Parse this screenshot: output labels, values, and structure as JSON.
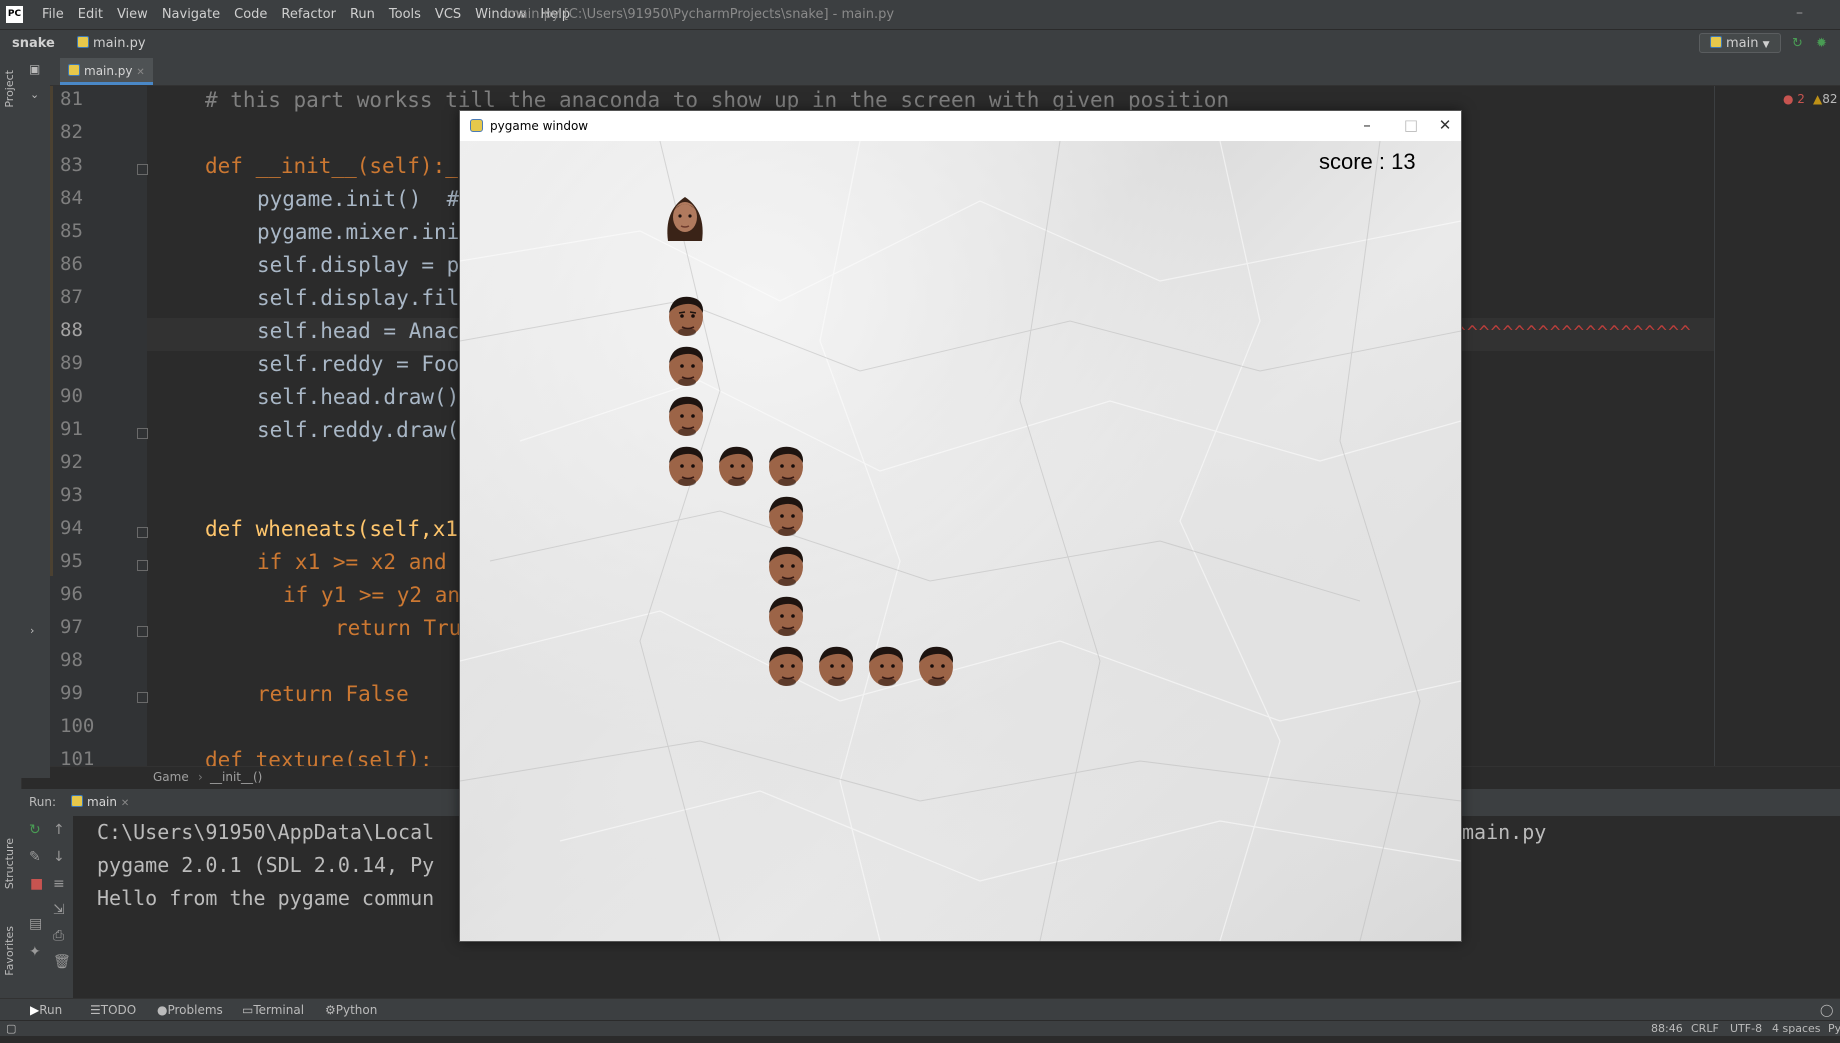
{
  "menubar": {
    "logo": "PC",
    "items": [
      "File",
      "Edit",
      "View",
      "Navigate",
      "Code",
      "Refactor",
      "Run",
      "Tools",
      "VCS",
      "Window",
      "Help"
    ],
    "window_title": "main.py [C:\\Users\\91950\\PycharmProjects\\snake] - main.py",
    "minimize": "–"
  },
  "navbar": {
    "project": "snake",
    "file": "main.py",
    "run_config": "main"
  },
  "leftstrip": {
    "project_label": "Project",
    "structure_label": "Structure",
    "favorites_label": "Favorites"
  },
  "editor": {
    "tab": "main.py",
    "inspections": {
      "errors": "2",
      "warnings": "82"
    },
    "lines": [
      {
        "n": "81",
        "code": "# this part workss till the anaconda to show up in the screen with given position"
      },
      {
        "n": "82",
        "code": ""
      },
      {
        "n": "83",
        "code": "def __init__(self):_"
      },
      {
        "n": "84",
        "code": "pygame.init()  #"
      },
      {
        "n": "85",
        "code": "pygame.mixer.ini"
      },
      {
        "n": "86",
        "code": "self.display = p"
      },
      {
        "n": "87",
        "code": "self.display.fil"
      },
      {
        "n": "88",
        "code": "self.head = Anac"
      },
      {
        "n": "89",
        "code": "self.reddy = Foo"
      },
      {
        "n": "90",
        "code": "self.head.draw()"
      },
      {
        "n": "91",
        "code": "self.reddy.draw("
      },
      {
        "n": "92",
        "code": ""
      },
      {
        "n": "93",
        "code": ""
      },
      {
        "n": "94",
        "code": "def wheneats(self,x1"
      },
      {
        "n": "95",
        "code": "if x1 >= x2 and"
      },
      {
        "n": "96",
        "code": "if y1 >= y2 an"
      },
      {
        "n": "97",
        "code": "return Tru"
      },
      {
        "n": "98",
        "code": ""
      },
      {
        "n": "99",
        "code": "return False"
      },
      {
        "n": "100",
        "code": ""
      },
      {
        "n": "101",
        "code": "def texture(self):"
      }
    ],
    "squiggle": "^^^^^^^^^^^^^^^^^^^^"
  },
  "breadcrumb": {
    "cls": "Game",
    "method": "__init__()"
  },
  "run": {
    "label": "Run:",
    "tab": "main",
    "console": [
      "C:\\Users\\91950\\AppData\\Local",
      "pygame 2.0.1 (SDL 2.0.14, Py",
      "Hello from the pygame commun"
    ],
    "console_tail": "main.py"
  },
  "bottomtools": {
    "run": "Run",
    "todo": "TODO",
    "problems": "Problems",
    "terminal": "Terminal",
    "python_console": "Python Console"
  },
  "status": {
    "position": "88:46",
    "line_sep": "CRLF",
    "encoding": "UTF-8",
    "indent": "4 spaces",
    "interp": "Py"
  },
  "pygame": {
    "title": "pygame window",
    "score": "score : 13",
    "food_count": 1,
    "snake_length": 13,
    "colors": {
      "canvas": "#e4e4e4",
      "skin": "#a86a4b"
    }
  }
}
